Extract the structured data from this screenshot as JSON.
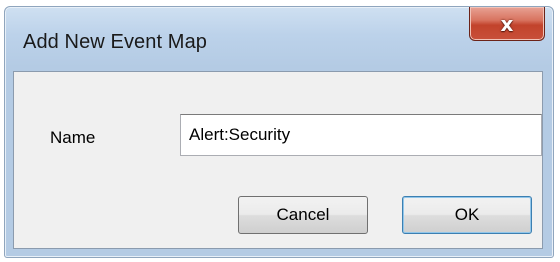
{
  "dialog": {
    "title": "Add New Event Map",
    "close_icon": "close-icon",
    "close_glyph": "x"
  },
  "form": {
    "name_label": "Name",
    "name_value": "Alert:Security"
  },
  "buttons": {
    "cancel_label": "Cancel",
    "ok_label": "OK"
  },
  "colors": {
    "close_button": "#c8503a",
    "title_bar": "#bcd2ea",
    "ok_border": "#3c7fb1"
  }
}
